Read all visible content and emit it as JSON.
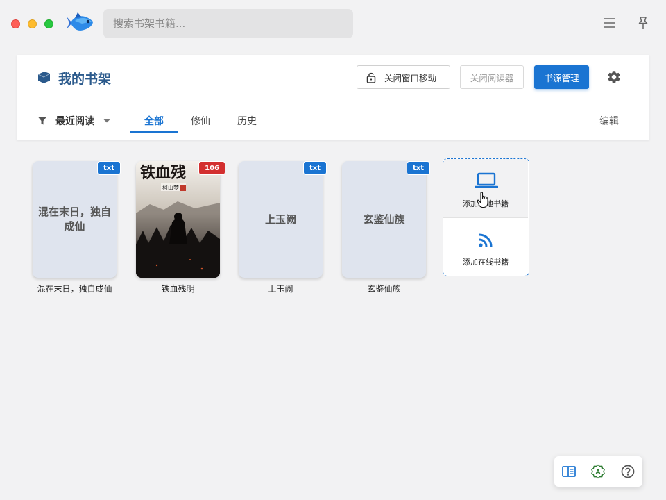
{
  "search": {
    "placeholder": "搜索书架书籍..."
  },
  "header": {
    "title": "我的书架",
    "buttons": {
      "lock_window": "关闭窗口移动",
      "close_reader": "关闭阅读器",
      "source_manage": "书源管理"
    }
  },
  "filter": {
    "label": "最近阅读"
  },
  "tabs": [
    {
      "label": "全部",
      "active": true
    },
    {
      "label": "修仙"
    },
    {
      "label": "历史"
    }
  ],
  "edit_label": "编辑",
  "books": [
    {
      "cover_text": "混在末日，独自成仙",
      "name": "混在末日，独自成仙",
      "badge": "txt"
    },
    {
      "name": "铁血残明",
      "badge": "106",
      "cover_title": "铁血残",
      "cover_author": "柯山梦"
    },
    {
      "cover_text": "上玉阙",
      "name": "上玉阙",
      "badge": "txt"
    },
    {
      "cover_text": "玄鉴仙族",
      "name": "玄鉴仙族",
      "badge": "txt"
    }
  ],
  "add_panel": {
    "local_label": "添加本地书籍",
    "online_label": "添加在线书籍"
  },
  "colors": {
    "accent": "#1a74d2",
    "title": "#2b5a8c",
    "badge_red": "#d32f2f"
  },
  "icons": [
    "fish-logo-icon",
    "menu-icon",
    "pin-icon",
    "bookshelf-icon",
    "lock-icon",
    "gear-icon",
    "filter-icon",
    "caret-down-icon",
    "laptop-icon",
    "rss-icon",
    "hand-cursor-icon",
    "reader-panel-icon",
    "translate-icon",
    "help-icon"
  ]
}
